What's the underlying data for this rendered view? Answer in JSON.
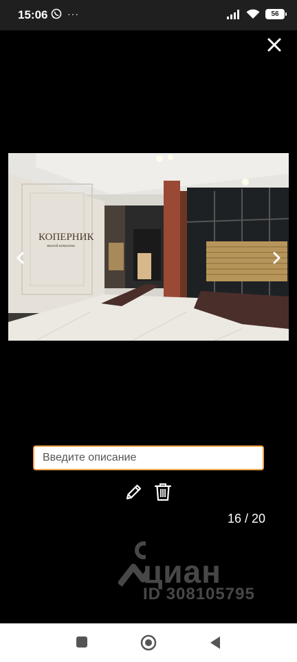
{
  "status": {
    "time": "15:06",
    "more": "···",
    "battery": "56",
    "icons": [
      "whatsapp-icon",
      "signal-icon",
      "wifi-icon",
      "battery-icon"
    ]
  },
  "viewer": {
    "photo_sign_title": "КОПЕРНИК",
    "photo_sign_subtitle": "жилой комплекс",
    "description_placeholder": "Введите описание",
    "description_value": "",
    "counter": "16 / 20"
  },
  "watermark": {
    "brand": "циан",
    "id": "ID 308105795"
  },
  "colors": {
    "accent": "#f2a449",
    "background": "#000000",
    "status_bar": "#1f1f1f"
  }
}
